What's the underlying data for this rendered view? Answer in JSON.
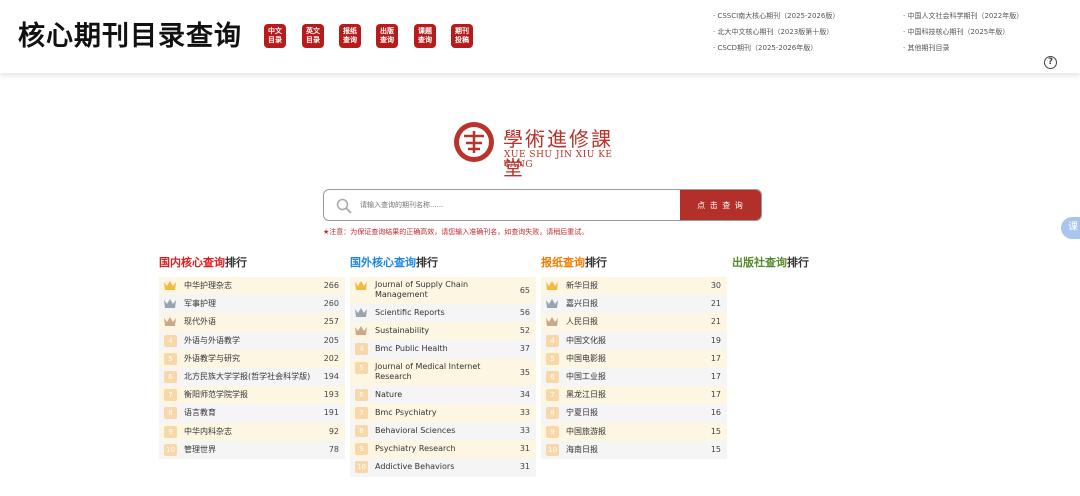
{
  "header": {
    "title": "核心期刊目录查询",
    "nav_buttons": [
      "中文\n目录",
      "英文\n目录",
      "报纸\n查询",
      "出版\n查询",
      "课题\n查询",
      "期刊\n投稿"
    ],
    "links_left": [
      "· CSSCI南大核心期刊（2025-2026版）",
      "· 北大中文核心期刊（2023版第十版）",
      "· CSCD期刊（2025-2026年版）"
    ],
    "links_right": [
      "· 中国人文社会科学期刊（2022年版）",
      "· 中国科技核心期刊（2025年版）",
      "· 其他期刊目录"
    ],
    "help": "?"
  },
  "logo": {
    "name": "學術進修課堂",
    "sub": "XUE SHU JIN XIU KE TANG"
  },
  "search": {
    "placeholder": "请输入查询的期刊名称......",
    "button": "点 击 查 询",
    "notice": "★注意：为保证查询结果的正确高效，请您输入准确刊名，如查询失败，请稍后重试。"
  },
  "side_tab": "课",
  "colors": {
    "accent": "#b23029",
    "domestic_title": "#e02020",
    "foreign_title": "#1e88e5",
    "newspaper_title": "#f57c00",
    "publisher_title": "#558b2f",
    "gold": "#f5b841",
    "silver": "#9aa4b0",
    "bronze": "#c9a98a"
  },
  "columns": [
    {
      "title_colored": "国内核心查询",
      "title_rest": "排行",
      "color_key": "domestic_title",
      "rows": [
        {
          "rank": "1",
          "name": "中华护理杂志",
          "count": "266"
        },
        {
          "rank": "2",
          "name": "军事护理",
          "count": "260"
        },
        {
          "rank": "3",
          "name": "现代外语",
          "count": "257"
        },
        {
          "rank": "4",
          "name": "外语与外语教学",
          "count": "205"
        },
        {
          "rank": "5",
          "name": "外语教学与研究",
          "count": "202"
        },
        {
          "rank": "6",
          "name": "北方民族大学学报(哲学社会科学版)",
          "count": "194"
        },
        {
          "rank": "7",
          "name": "衡阳师范学院学报",
          "count": "193"
        },
        {
          "rank": "8",
          "name": "语言教育",
          "count": "191"
        },
        {
          "rank": "9",
          "name": "中华内科杂志",
          "count": "92"
        },
        {
          "rank": "10",
          "name": "管理世界",
          "count": "78"
        }
      ]
    },
    {
      "title_colored": "国外核心查询",
      "title_rest": "排行",
      "color_key": "foreign_title",
      "rows": [
        {
          "rank": "1",
          "name": "Journal of Supply Chain Management",
          "count": "65"
        },
        {
          "rank": "2",
          "name": "Scientific Reports",
          "count": "56"
        },
        {
          "rank": "3",
          "name": "Sustainability",
          "count": "52"
        },
        {
          "rank": "4",
          "name": "Bmc Public Health",
          "count": "37"
        },
        {
          "rank": "5",
          "name": "Journal of Medical Internet Research",
          "count": "35"
        },
        {
          "rank": "6",
          "name": "Nature",
          "count": "34"
        },
        {
          "rank": "7",
          "name": "Bmc Psychiatry",
          "count": "33"
        },
        {
          "rank": "8",
          "name": "Behavioral Sciences",
          "count": "33"
        },
        {
          "rank": "9",
          "name": "Psychiatry Research",
          "count": "31"
        },
        {
          "rank": "10",
          "name": "Addictive Behaviors",
          "count": "31"
        }
      ]
    },
    {
      "title_colored": "报纸查询",
      "title_rest": "排行",
      "color_key": "newspaper_title",
      "rows": [
        {
          "rank": "1",
          "name": "新华日报",
          "count": "30"
        },
        {
          "rank": "2",
          "name": "嘉兴日报",
          "count": "21"
        },
        {
          "rank": "3",
          "name": "人民日报",
          "count": "21"
        },
        {
          "rank": "4",
          "name": "中国文化报",
          "count": "19"
        },
        {
          "rank": "5",
          "name": "中国电影报",
          "count": "17"
        },
        {
          "rank": "6",
          "name": "中国工业报",
          "count": "17"
        },
        {
          "rank": "7",
          "name": "黑龙江日报",
          "count": "17"
        },
        {
          "rank": "8",
          "name": "宁夏日报",
          "count": "16"
        },
        {
          "rank": "9",
          "name": "中国旅游报",
          "count": "15"
        },
        {
          "rank": "10",
          "name": "海南日报",
          "count": "15"
        }
      ]
    },
    {
      "title_colored": "出版社查询",
      "title_rest": "排行",
      "color_key": "publisher_title",
      "rows": []
    }
  ]
}
